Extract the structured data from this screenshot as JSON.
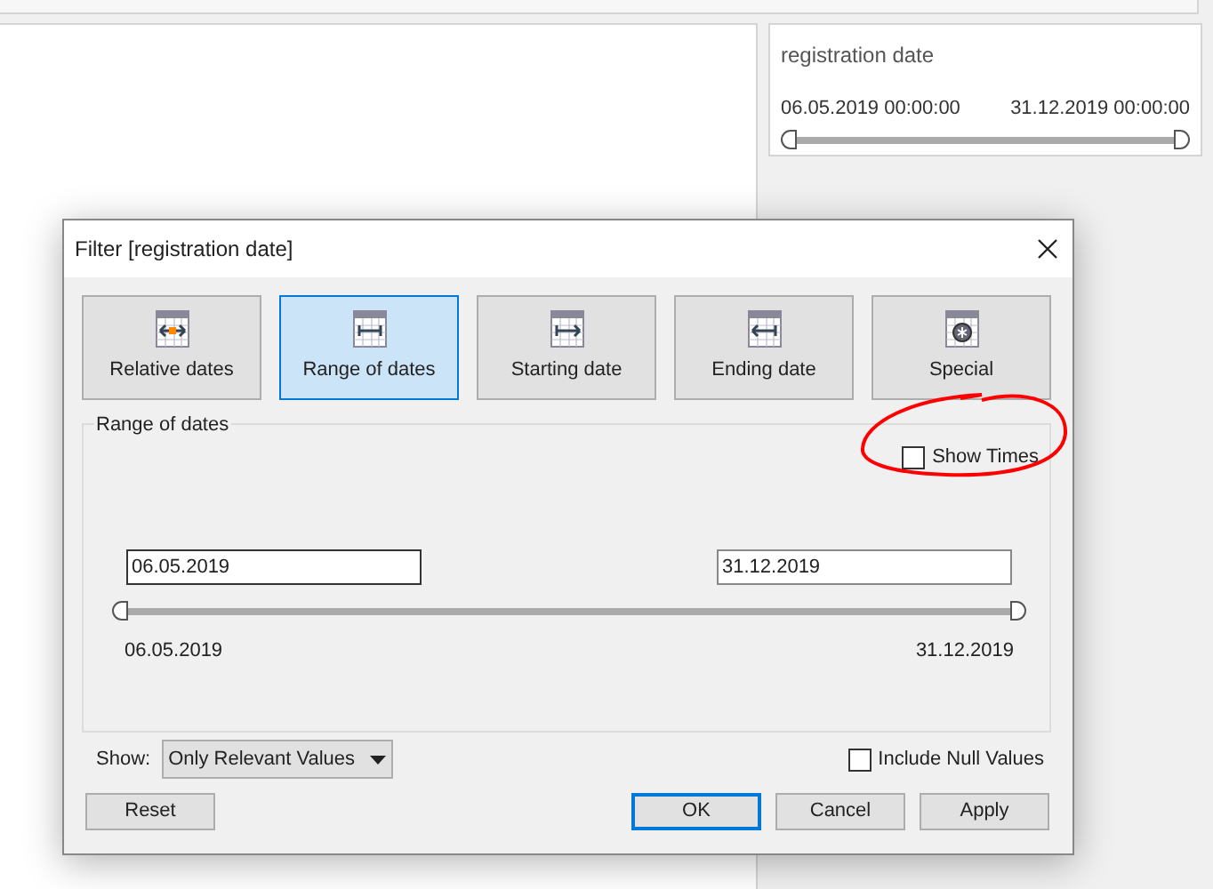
{
  "filter_card": {
    "title": "registration date",
    "start": "06.05.2019 00:00:00",
    "end": "31.12.2019 00:00:00",
    "slider": {
      "level": 1
    }
  },
  "dialog": {
    "title": "Filter [registration date]",
    "modes": [
      {
        "label": "Relative dates",
        "kind": "relative",
        "selected": false
      },
      {
        "label": "Range of dates",
        "kind": "range",
        "selected": true
      },
      {
        "label": "Starting date",
        "kind": "start",
        "selected": false
      },
      {
        "label": "Ending date",
        "kind": "end",
        "selected": false
      },
      {
        "label": "Special",
        "kind": "special",
        "selected": false
      }
    ],
    "group_title": "Range of dates",
    "show_times": {
      "label": "Show Times",
      "checked": false
    },
    "start_field": "06.05.2019",
    "end_field": "31.12.2019",
    "slider": {
      "level": 1
    },
    "min_label": "06.05.2019",
    "max_label": "31.12.2019",
    "show_label": "Show:",
    "show_value": "Only Relevant Values",
    "include_null": {
      "label": "Include Null Values",
      "checked": false
    },
    "buttons": [
      {
        "label": "Reset",
        "kind": "left",
        "selected": false
      },
      {
        "label": "OK",
        "kind": "right",
        "selected": true
      },
      {
        "label": "Cancel",
        "kind": "right",
        "selected": false
      },
      {
        "label": "Apply",
        "kind": "right",
        "selected": false
      }
    ]
  }
}
